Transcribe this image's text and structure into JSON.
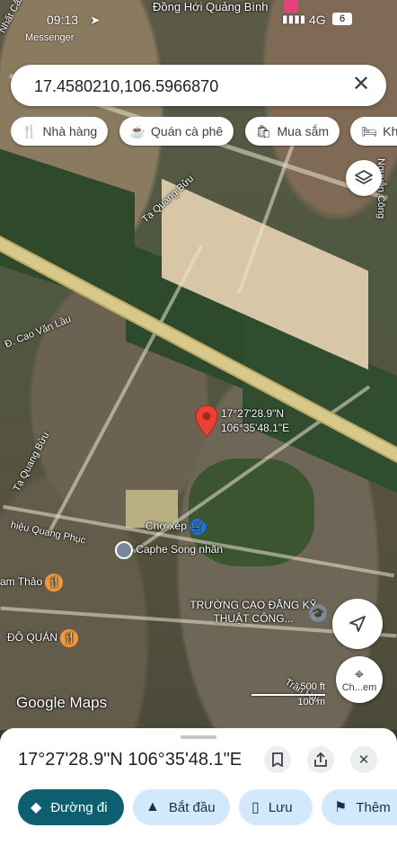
{
  "status": {
    "time": "09:13",
    "network": "4G",
    "battery": "6",
    "back_app": "Messenger"
  },
  "map": {
    "top_label": "Đồng Hới Quảng Bình",
    "streets": [
      "Nhất Cảnh Mễ",
      "Tạ Quang Bửu",
      "Đ. Cao Văn Lầu",
      "Tạ Quang Bửu",
      "hiệu Quang Phục",
      "Nguyễn Công",
      "Trần Hải"
    ],
    "pois": [
      {
        "name": "Chợ xép",
        "icon": "cart-icon"
      },
      {
        "name": "Caphe Song nhãn",
        "icon": "dot-icon"
      },
      {
        "name": "am Thảo",
        "icon": "restaurant-icon"
      },
      {
        "name": "ĐÔ QUÁN",
        "icon": "restaurant-icon"
      },
      {
        "name": "TRƯỜNG CAO ĐẲNG KỸ THUẬT CÔNG...",
        "icon": "school-icon"
      }
    ],
    "pin_label": {
      "lat": "17°27'28.9\"N",
      "lng": "106°35'48.1\"E"
    },
    "scale": {
      "top": "500 ft",
      "bottom": "100 m"
    },
    "brand": "Google Maps",
    "street_view_label": "Ch...em"
  },
  "search": {
    "value": "17.4580210,106.5966870",
    "clear_icon": "close-icon"
  },
  "chips": [
    {
      "label": "Nhà hàng",
      "icon": "restaurant-icon"
    },
    {
      "label": "Quán cà phê",
      "icon": "coffee-icon"
    },
    {
      "label": "Mua sắm",
      "icon": "shopping-bag-icon"
    },
    {
      "label": "Khách",
      "icon": "hotel-icon"
    }
  ],
  "sheet": {
    "title": "17°27'28.9\"N 106°35'48.1\"E",
    "actions": [
      {
        "label": "Đường đi",
        "icon": "directions-icon"
      },
      {
        "label": "Bắt đầu",
        "icon": "navigation-icon"
      },
      {
        "label": "Lưu",
        "icon": "bookmark-icon"
      },
      {
        "label": "Thêm",
        "icon": "flag-icon"
      }
    ]
  },
  "colors": {
    "primary": "#0b5f71",
    "chip_bg": "#d3e8fa",
    "pin": "#ea4335"
  }
}
